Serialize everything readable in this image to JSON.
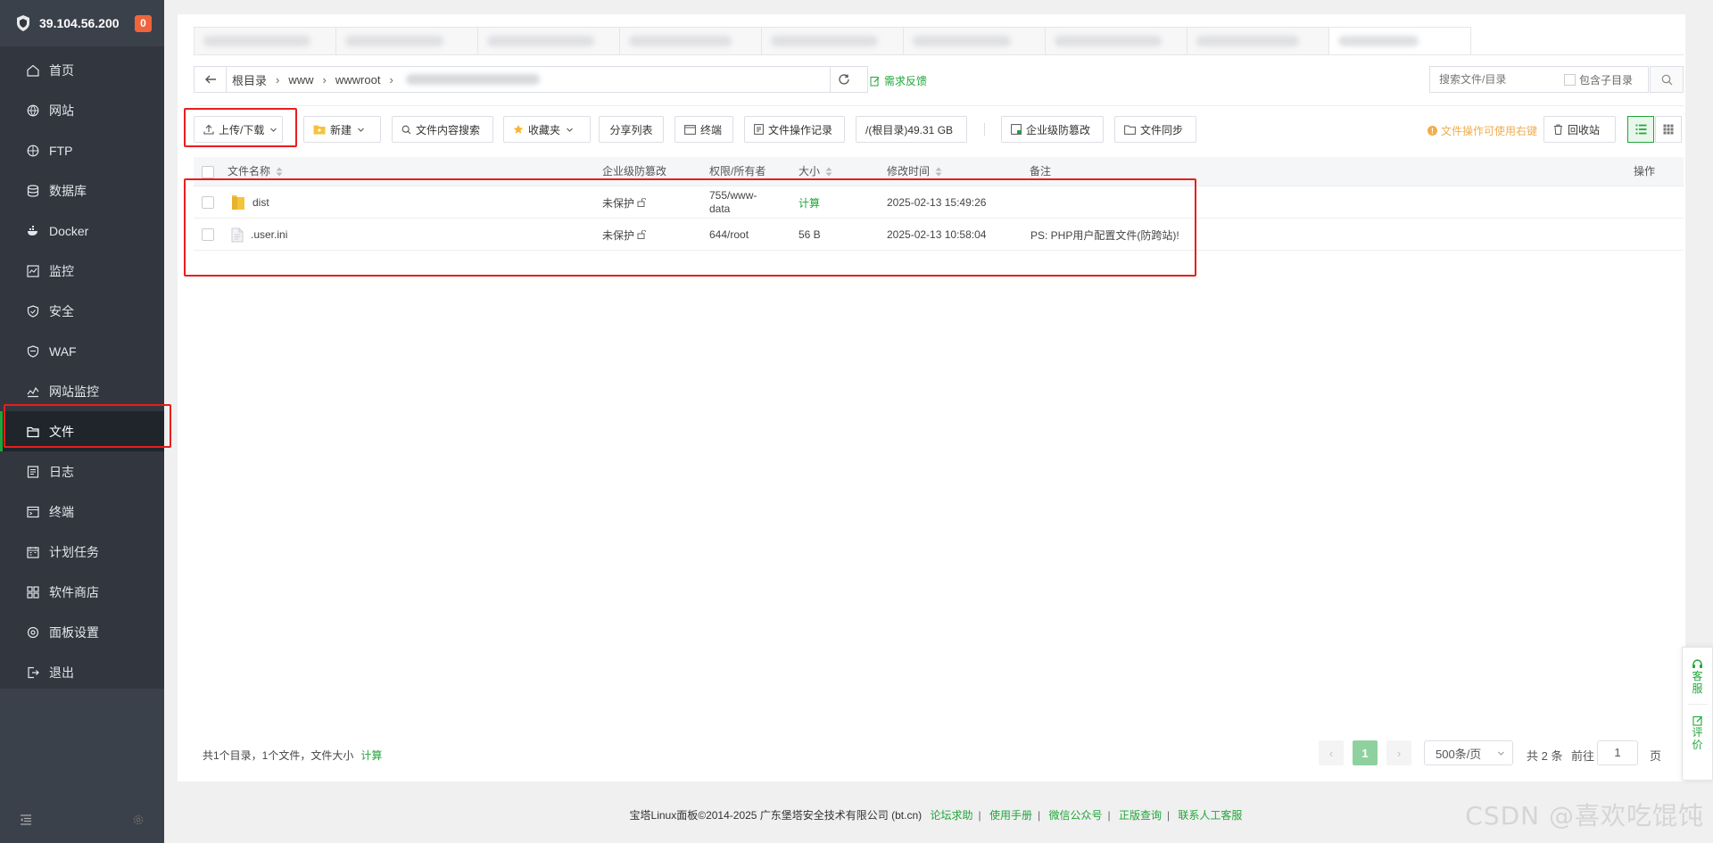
{
  "server": {
    "ip": "39.104.56.200",
    "badge": "0"
  },
  "sidebar": {
    "items": [
      {
        "label": "首页",
        "icon": "home-icon"
      },
      {
        "label": "网站",
        "icon": "globe-icon"
      },
      {
        "label": "FTP",
        "icon": "ftp-icon"
      },
      {
        "label": "数据库",
        "icon": "database-icon"
      },
      {
        "label": "Docker",
        "icon": "docker-icon"
      },
      {
        "label": "监控",
        "icon": "monitor-icon"
      },
      {
        "label": "安全",
        "icon": "shield-icon"
      },
      {
        "label": "WAF",
        "icon": "waf-shield-icon"
      },
      {
        "label": "网站监控",
        "icon": "chart-line-icon"
      },
      {
        "label": "文件",
        "icon": "folder-icon"
      },
      {
        "label": "日志",
        "icon": "log-icon"
      },
      {
        "label": "终端",
        "icon": "terminal-icon"
      },
      {
        "label": "计划任务",
        "icon": "calendar-icon"
      },
      {
        "label": "软件商店",
        "icon": "apps-icon"
      },
      {
        "label": "面板设置",
        "icon": "settings-icon"
      },
      {
        "label": "退出",
        "icon": "logout-icon"
      }
    ],
    "active_index": 9
  },
  "path": {
    "crumbs": [
      "根目录",
      "www",
      "wwwroot"
    ],
    "feedback": "需求反馈"
  },
  "search": {
    "placeholder": "搜索文件/目录",
    "include_sub": "包含子目录"
  },
  "toolbar": {
    "upload": "上传/下载",
    "new": "新建",
    "content_search": "文件内容搜索",
    "favorites": "收藏夹",
    "share_list": "分享列表",
    "terminal": "终端",
    "op_log": "文件操作记录",
    "disk": "/(根目录)49.31 GB",
    "tamper": "企业级防篡改",
    "sync": "文件同步",
    "tip": "文件操作可使用右键",
    "recycle": "回收站"
  },
  "table": {
    "headers": {
      "name": "文件名称",
      "tamper": "企业级防篡改",
      "perm": "权限/所有者",
      "size": "大小",
      "mtime": "修改时间",
      "remark": "备注",
      "ops": "操作"
    },
    "rows": [
      {
        "name": "dist",
        "type": "folder",
        "tamper": "未保护",
        "perm": "755/www-data",
        "size": "计算",
        "mtime": "2025-02-13 15:49:26",
        "remark": ""
      },
      {
        "name": ".user.ini",
        "type": "file",
        "tamper": "未保护",
        "perm": "644/root",
        "size": "56 B",
        "mtime": "2025-02-13 10:58:04",
        "remark": "PS: PHP用户配置文件(防跨站)!"
      }
    ]
  },
  "summary": {
    "text": "共1个目录，1个文件，文件大小",
    "calc": "计算"
  },
  "pagination": {
    "current": "1",
    "per_page": "500条/页",
    "total": "共 2 条",
    "goto_label": "前往",
    "goto_value": "1",
    "page_unit": "页"
  },
  "footer": {
    "copyright": "宝塔Linux面板©2014-2025 广东堡塔安全技术有限公司 (bt.cn)",
    "links": [
      "论坛求助",
      "使用手册",
      "微信公众号",
      "正版查询",
      "联系人工客服"
    ]
  },
  "float": {
    "service": "客服",
    "review": "评价"
  },
  "watermark": "CSDN @喜欢吃馄饨",
  "colors": {
    "accent": "#20a53a",
    "sidebar_bg": "#31363f",
    "highlight": "#e81e1e",
    "warning": "#f0ad4e"
  }
}
